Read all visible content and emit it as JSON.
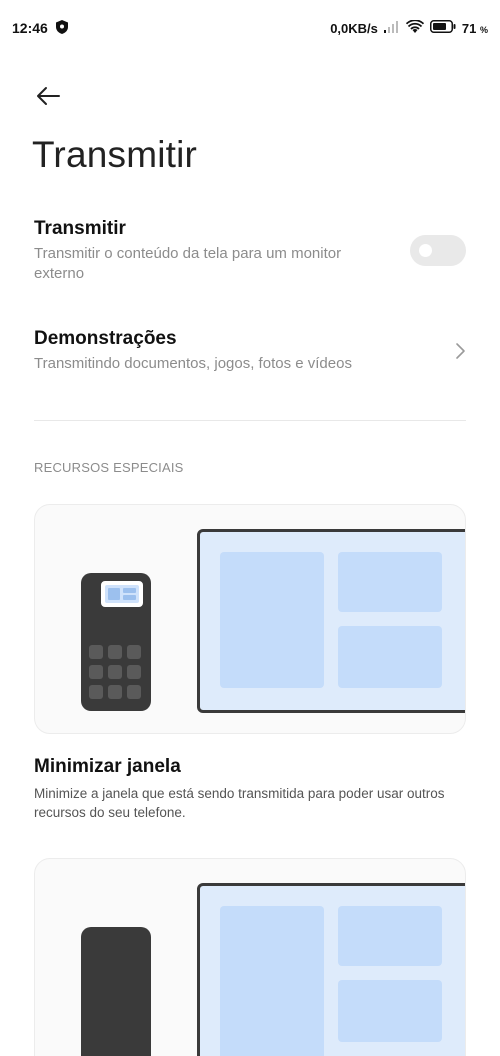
{
  "status_bar": {
    "time": "12:46",
    "network_speed": "0,0KB/s",
    "battery_percent": "71",
    "battery_unit": "%",
    "icons": [
      "shield-icon",
      "signal-icon",
      "wifi-icon",
      "battery-icon"
    ]
  },
  "header": {
    "back_icon": "arrow-left-icon",
    "title": "Transmitir"
  },
  "settings": {
    "cast": {
      "title": "Transmitir",
      "subtitle": "Transmitir o conteúdo da tela para um monitor externo",
      "toggle_on": false
    },
    "demos": {
      "title": "Demonstrações",
      "subtitle": "Transmitindo documentos, jogos, fotos e vídeos",
      "chevron_icon": "chevron-right-icon"
    }
  },
  "special_features": {
    "header": "RECURSOS ESPECIAIS",
    "items": [
      {
        "title": "Minimizar janela",
        "description": "Minimize a janela que está sendo transmitida para poder usar outros recursos do seu telefone."
      }
    ]
  },
  "colors": {
    "accent_blue_light": "#deebfb",
    "accent_blue": "#c4dcfa",
    "device_dark": "#3a3a3a",
    "toggle_off": "#e9e9e9",
    "secondary_text": "#8c8c8c"
  }
}
